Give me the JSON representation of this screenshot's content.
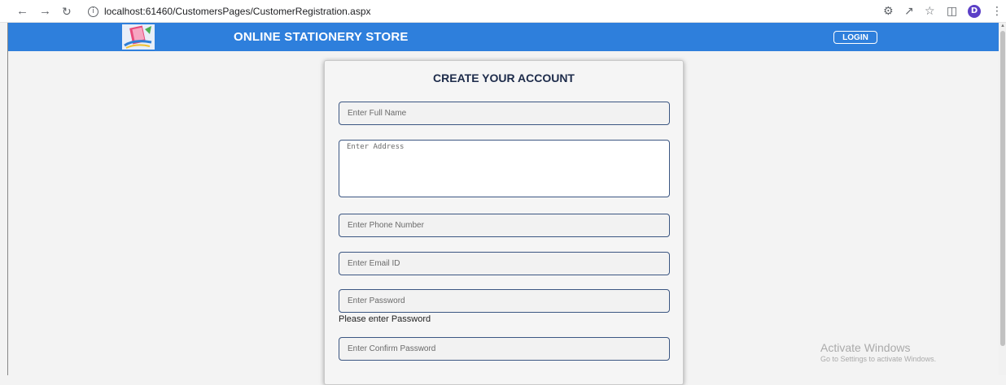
{
  "browser": {
    "url_host": "localhost",
    "url_path": ":61460/CustomersPages/CustomerRegistration.aspx",
    "avatar_letter": "D"
  },
  "header": {
    "title": "ONLINE STATIONERY STORE",
    "login_label": "LOGIN",
    "brand_color": "#2e7fdc"
  },
  "form": {
    "title": "CREATE YOUR ACCOUNT",
    "fields": {
      "full_name": {
        "placeholder": "Enter Full Name",
        "value": ""
      },
      "address": {
        "placeholder": "Enter Address",
        "value": ""
      },
      "phone": {
        "placeholder": "Enter Phone Number",
        "value": ""
      },
      "email": {
        "placeholder": "Enter Email ID",
        "value": ""
      },
      "password": {
        "placeholder": "Enter Password",
        "value": ""
      },
      "confirm_password": {
        "placeholder": "Enter Confirm Password",
        "value": ""
      }
    },
    "password_error": "Please enter Password"
  },
  "watermark": {
    "title": "Activate Windows",
    "subtitle": "Go to Settings to activate Windows."
  }
}
